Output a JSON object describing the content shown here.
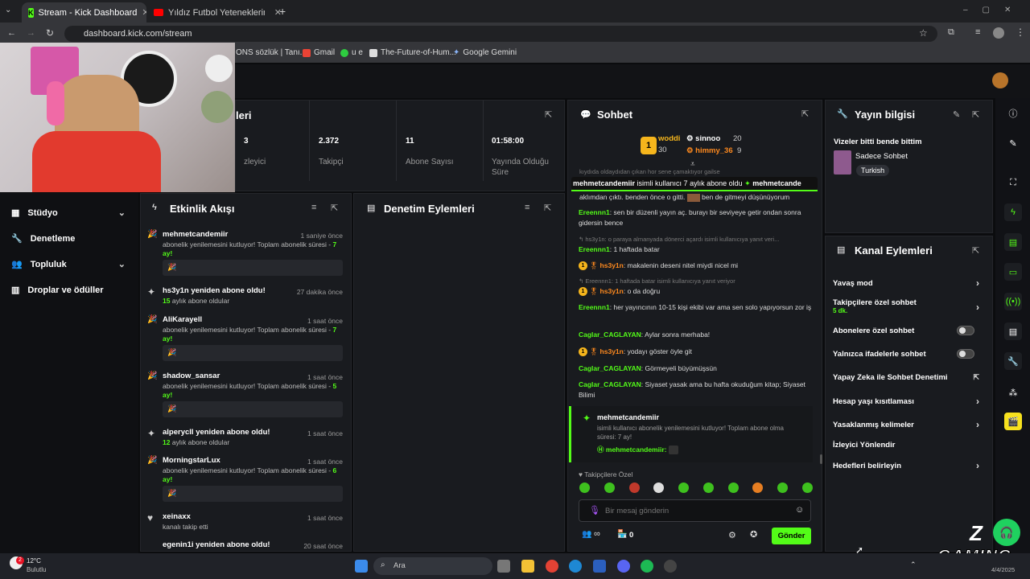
{
  "browser": {
    "tabs": [
      {
        "label": "Stream - Kick Dashboard",
        "active": true
      },
      {
        "label": "Yıldız Futbol Yeteneklerimi Puan",
        "active": false
      }
    ],
    "new_tab": "+",
    "url": "dashboard.kick.com/stream",
    "bookmarks": [
      "ONS sözlük | Tanı...",
      "Gmail",
      "u e",
      "The-Future-of-Hum...",
      "Google Gemini"
    ]
  },
  "colors": {
    "accent": "#53fc18",
    "gold": "#f5b51c",
    "orange": "#ff8a1f"
  },
  "stats": {
    "title": "İstatistikleri",
    "title_visible": "leri",
    "items": [
      {
        "value": "3",
        "label": "zleyici"
      },
      {
        "value": "2.372",
        "label": "Takipçi"
      },
      {
        "value": "11",
        "label": "Abone Sayısı"
      },
      {
        "value": "01:58:00",
        "label": "Yayında Olduğu Süre"
      }
    ]
  },
  "sidebar": {
    "items": [
      {
        "label": "Stüdyo",
        "icon": "grid-icon",
        "has_chevron": true
      },
      {
        "label": "Denetleme",
        "icon": "wrench-icon",
        "has_chevron": false
      },
      {
        "label": "Topluluk",
        "icon": "users-icon",
        "has_chevron": true
      },
      {
        "label": "Droplar ve ödüller",
        "icon": "gift-icon",
        "has_chevron": false
      }
    ]
  },
  "activity": {
    "title": "Etkinlik Akışı",
    "items": [
      {
        "name": "mehmetcandemiir",
        "time": "1 saniye önce",
        "desc": "abonelik yenilemesini kutluyor! Toplam abonelik süresi -",
        "months": "7 ay!",
        "box": "🎉"
      },
      {
        "name": "hs3y1n yeniden abone oldu!",
        "time": "27 dakika önce",
        "months_count": "15",
        "desc2": "aylık abone oldular"
      },
      {
        "name": "AliKarayell",
        "time": "1 saat önce",
        "desc": "abonelik yenilemesini kutluyor! Toplam abonelik süresi -",
        "months": "7 ay!",
        "box": "🎉"
      },
      {
        "name": "shadow_sansar",
        "time": "1 saat önce",
        "desc": "abonelik yenilemesini kutluyor! Toplam abonelik süresi -",
        "months": "5 ay!",
        "box": "🎉"
      },
      {
        "name": "alperycll yeniden abone oldu!",
        "time": "1 saat önce",
        "months_count": "12",
        "desc2": "aylık abone oldular"
      },
      {
        "name": "MorningstarLux",
        "time": "1 saat önce",
        "desc": "abonelik yenilemesini kutluyor! Toplam abonelik süresi -",
        "months": "6 ay!",
        "box": "🎉"
      },
      {
        "name": "xeinaxx",
        "time": "1 saat önce",
        "desc": "kanalı takip etti"
      },
      {
        "name": "egenin1i yeniden abone oldu!",
        "time": "20 saat önce"
      }
    ]
  },
  "moderation": {
    "title": "Denetim Eylemleri"
  },
  "chat": {
    "title": "Sohbet",
    "leaderboard": [
      {
        "rank": "1",
        "name": "woddi",
        "count": "30"
      },
      {
        "name": "sinnoo",
        "count": "20"
      },
      {
        "name": "himmy_36",
        "count": "9"
      }
    ],
    "sub_banner_user": "mehmetcandemiir",
    "sub_banner_text": "isimli kullanıcı 7 aylık abone oldu",
    "sub_banner_user2": "mehmetcande",
    "cut_line_1": "kıydıda oldaydıdan çıkan hor sene çamaktıyor gailse",
    "cut_line_2": "aklımdan çıktı. benden önce o gitti.",
    "cut_line_2b": "ben de gitmeyi düşünüyorum",
    "messages": [
      {
        "user": "Ereennn1",
        "text": "sen bir düzenli yayın aç. burayı bir seviyeye getir ondan sonra gidersin bence"
      },
      {
        "reply": "hs3y1n: o paraya almanyada dönerci açardı isimli kullanıcıya yanıt veri...",
        "user": "Ereennn1",
        "text": "1 haftada batar"
      },
      {
        "user": "hs3y1n",
        "text": "makalenin deseni nitel miydi nicel mi",
        "badge": true
      },
      {
        "reply": "Ereennn1: 1 haftada batar isimli kullanıcıya yanıt veriyor",
        "user": "hs3y1n",
        "text": "o da doğru",
        "badge": true
      },
      {
        "user": "Ereennn1",
        "text": "her yayıncının 10-15 kişi ekibi var ama sen solo yapıyorsun zor iş"
      },
      {
        "user": "Caglar_CAGLAYAN",
        "text": "Aylar sonra merhaba!"
      },
      {
        "user": "hs3y1n",
        "text": "yodayı göster öyle git",
        "badge": true
      },
      {
        "user": "Caglar_CAGLAYAN",
        "text": "Görmeyeli büyümüşsün"
      },
      {
        "user": "Caglar_CAGLAYAN",
        "text": "Siyaset yasak ama bu hafta okuduğum kitap; Siyaset Bilimi"
      }
    ],
    "sub_card": {
      "user": "mehmetcandemiir",
      "text": "isimli kullanıcı abonelik yenilemesini kutluyor! Toplam abone olma süresi: 7 ay!",
      "footer_user": "mehmetcandemiir:"
    },
    "emote_label": "Takipçilere Özel",
    "input_placeholder": "Bir mesaj gönderin",
    "infinity": "∞",
    "count": "0",
    "send": "Gönder"
  },
  "stream_info": {
    "title": "Yayın bilgisi",
    "stream_title": "Vizeler bitti bende bittim",
    "category": "Sadece Sohbet",
    "tag": "Turkish"
  },
  "channel_actions": {
    "title": "Kanal Eylemleri",
    "items": [
      {
        "label": "Yavaş mod",
        "type": "chevron"
      },
      {
        "label": "Takipçilere özel sohbet",
        "sub": "5 dk.",
        "type": "chevron"
      },
      {
        "label": "Abonelere özel sohbet",
        "type": "toggle"
      },
      {
        "label": "Yalnızca ifadelerle sohbet",
        "type": "toggle"
      },
      {
        "label": "Yapay Zeka ile Sohbet Denetimi",
        "type": "external"
      },
      {
        "label": "Hesap yaşı kısıtlaması",
        "type": "chevron"
      },
      {
        "label": "Yasaklanmış kelimeler",
        "type": "chevron"
      },
      {
        "label": "İzleyici Yönlendir",
        "type": "none"
      },
      {
        "label": "Hedefleri belirleyin",
        "type": "chevron"
      }
    ]
  },
  "taskbar": {
    "temp": "12°C",
    "weather": "Bulutlu",
    "search": "Ara",
    "notif": "2",
    "gaming_logo": "GAMING",
    "date": "4/4/2025"
  }
}
